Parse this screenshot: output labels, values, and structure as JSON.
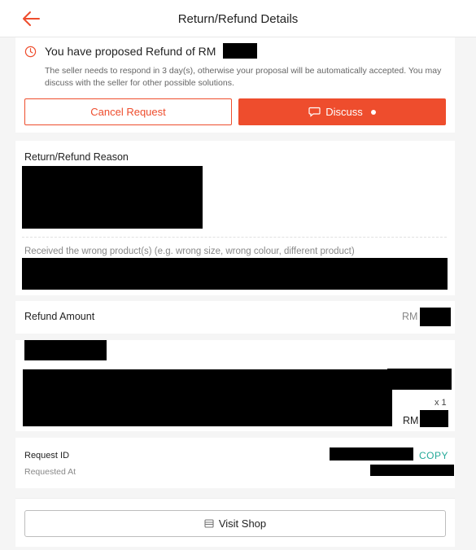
{
  "header": {
    "title": "Return/Refund Details",
    "back_icon": "arrow-left-icon",
    "accent": "#ee4d2d"
  },
  "proposal": {
    "title": "You have proposed Refund of RM",
    "description": "The seller needs to respond in 3 day(s), otherwise your proposal will be automatically accepted. You may discuss with the seller for other possible solutions.",
    "icon": "clock-icon",
    "cancel_label": "Cancel Request",
    "discuss_label": "Discuss",
    "discuss_icon": "chat-icon"
  },
  "reason": {
    "heading": "Return/Refund Reason",
    "text": "Received the wrong product(s) (e.g. wrong size, wrong colour, different product)"
  },
  "refund": {
    "label": "Refund Amount",
    "currency": "RM"
  },
  "product": {
    "quantity": "x 1",
    "currency": "RM"
  },
  "request": {
    "id_label": "Request ID",
    "copy_label": "COPY",
    "requested_label": "Requested At",
    "copy_color": "#26aa99"
  },
  "footer": {
    "visit_label": "Visit Shop",
    "shop_icon": "shop-icon"
  }
}
